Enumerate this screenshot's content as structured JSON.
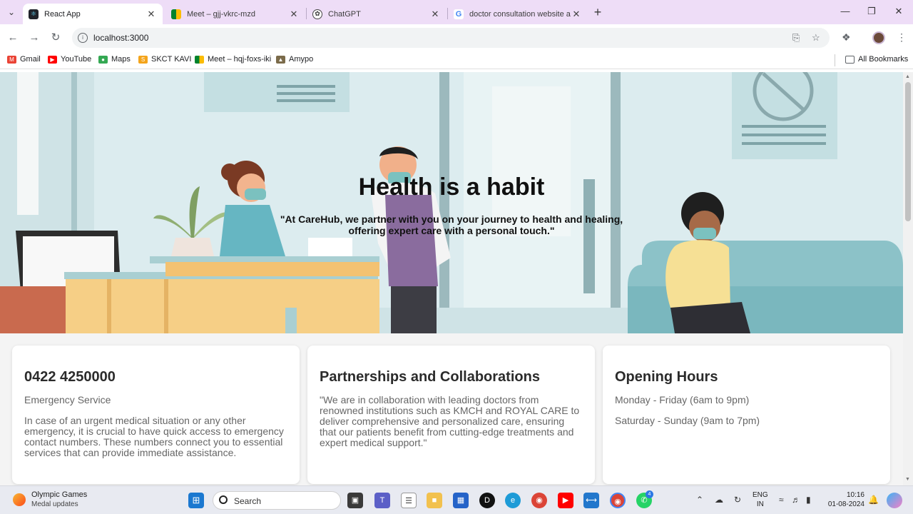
{
  "browser": {
    "tabs": [
      {
        "title": "React App",
        "icon": "react-icon",
        "active": true
      },
      {
        "title": "Meet – gjj-vkrc-mzd",
        "icon": "google-meet-icon",
        "active": false
      },
      {
        "title": "ChatGPT",
        "icon": "chatgpt-icon",
        "active": false
      },
      {
        "title": "doctor consultation website as",
        "icon": "google-icon",
        "active": false
      }
    ],
    "url": "localhost:3000",
    "bookmarks": [
      {
        "label": "Gmail",
        "icon": "gmail-icon"
      },
      {
        "label": "YouTube",
        "icon": "youtube-icon"
      },
      {
        "label": "Maps",
        "icon": "maps-icon"
      },
      {
        "label": "SKCT KAVI",
        "icon": "skct-icon"
      },
      {
        "label": "Meet – hqj-foxs-iki",
        "icon": "google-meet-icon"
      },
      {
        "label": "Amypo",
        "icon": "amypo-icon"
      }
    ],
    "all_bookmarks_label": "All Bookmarks"
  },
  "hero": {
    "title": "Health is a habit",
    "quote": "\"At CareHub, we partner with you on your journey to health and healing, offering expert care with a personal touch.\""
  },
  "cards": [
    {
      "title": "0422 4250000",
      "paragraphs": [
        "Emergency Service",
        "In case of an urgent medical situation or any other emergency, it is crucial to have quick access to emergency contact numbers. These numbers connect you to essential services that can provide immediate assistance."
      ]
    },
    {
      "title": "Partnerships and Collaborations",
      "paragraphs": [
        "\"We are in collaboration with leading doctors from renowned institutions such as KMCH and ROYAL CARE to deliver comprehensive and personalized care, ensuring that our patients benefit from cutting-edge treatments and expert medical support.\""
      ]
    },
    {
      "title": "Opening Hours",
      "paragraphs": [
        "Monday - Friday (6am to 9pm)",
        "Saturday - Sunday (9am to 7pm)"
      ]
    }
  ],
  "taskbar": {
    "widget_title": "Olympic Games",
    "widget_subtitle": "Medal updates",
    "search_placeholder": "Search",
    "language": "ENG",
    "region": "IN",
    "time": "10:16",
    "date": "01-08-2024",
    "teams_badge": "4"
  },
  "colors": {
    "tabbar": "#eeddf7",
    "hero_bg": "#dcecef",
    "card_title": "#2b2b2b",
    "card_text": "#666666"
  }
}
